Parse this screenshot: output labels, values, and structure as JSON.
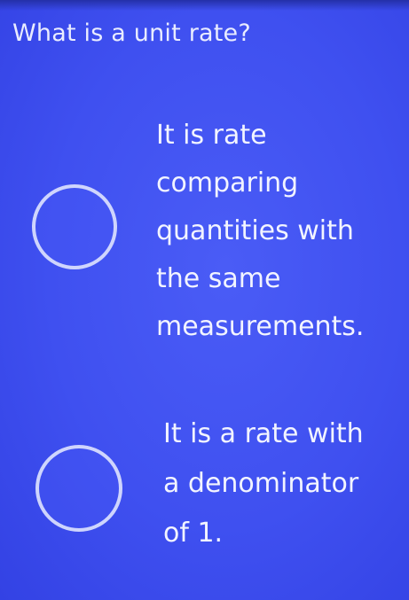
{
  "question": {
    "text": "What is a unit rate?"
  },
  "options": [
    {
      "text": "It is rate\ncomparing\nquantities with\nthe same\nmeasurements.",
      "selected": false
    },
    {
      "text": "It is a rate with\na denominator\nof 1.",
      "selected": false
    }
  ],
  "colors": {
    "background": "#4152f0",
    "text": "#f2f4ff",
    "radio_border": "#e2e8ff"
  }
}
